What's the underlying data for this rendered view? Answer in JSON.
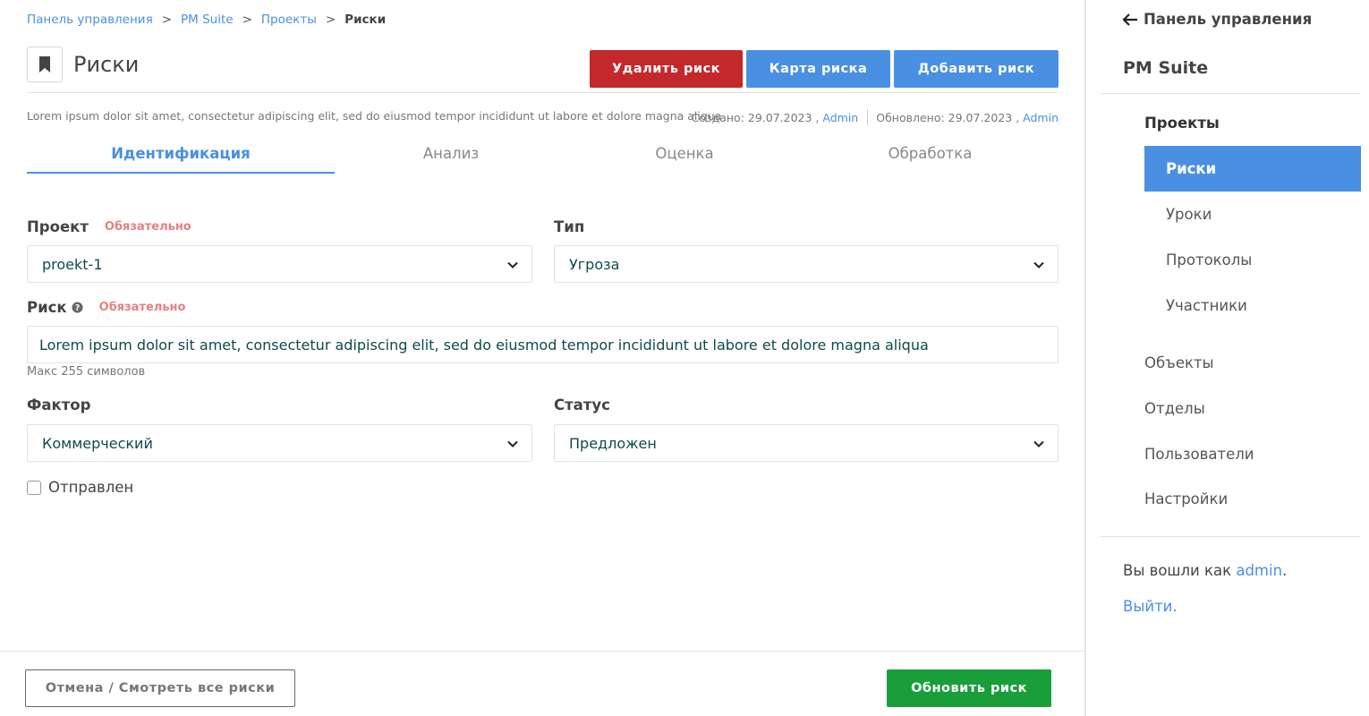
{
  "breadcrumb": {
    "items": [
      "Панель управления",
      "PM Suite",
      "Проекты"
    ],
    "current": "Риски",
    "separator": ">"
  },
  "header": {
    "icon": "bookmark-icon",
    "title": "Риски",
    "buttons": {
      "delete": "Удалить риск",
      "map": "Карта риска",
      "add": "Добавить риск"
    }
  },
  "meta": {
    "description": "Lorem ipsum dolor sit amet, consectetur adipiscing elit, sed do eiusmod tempor incididunt ut labore et dolore magna aliqua",
    "created_label": "Создано: 29.07.2023 ,",
    "created_by": "Admin",
    "updated_label": "Обновлено: 29.07.2023 ,",
    "updated_by": "Admin"
  },
  "tabs": [
    {
      "label": "Идентификация",
      "active": true
    },
    {
      "label": "Анализ",
      "active": false
    },
    {
      "label": "Оценка",
      "active": false
    },
    {
      "label": "Обработка",
      "active": false
    }
  ],
  "form": {
    "project": {
      "label": "Проект",
      "required": "Обязательно",
      "value": "proekt-1"
    },
    "type": {
      "label": "Тип",
      "value": "Угроза"
    },
    "risk": {
      "label": "Риск",
      "required": "Обязательно",
      "value": "Lorem ipsum dolor sit amet, consectetur adipiscing elit, sed do eiusmod tempor incididunt ut labore et dolore magna aliqua",
      "hint": "Макс 255 символов"
    },
    "factor": {
      "label": "Фактор",
      "value": "Коммерческий"
    },
    "status": {
      "label": "Статус",
      "value": "Предложен"
    },
    "sent": {
      "label": "Отправлен",
      "checked": false
    }
  },
  "footer": {
    "cancel": "Отмена / Смотреть все риски",
    "update": "Обновить риск"
  },
  "sidebar": {
    "back": "Панель управления",
    "suite": "PM Suite",
    "projects_header": "Проекты",
    "project_sub": [
      "Риски",
      "Уроки",
      "Протоколы",
      "Участники"
    ],
    "items": [
      "Объекты",
      "Отделы",
      "Пользователи",
      "Настройки"
    ],
    "login_prefix": "Вы вошли как",
    "login_user": "admin",
    "login_suffix": ".",
    "logout": "Выйти."
  },
  "colors": {
    "accent": "#4a90e2",
    "danger": "#c3282b",
    "success": "#1a9e3a",
    "required": "#e06c6c",
    "value_text": "#0f4a4a"
  }
}
